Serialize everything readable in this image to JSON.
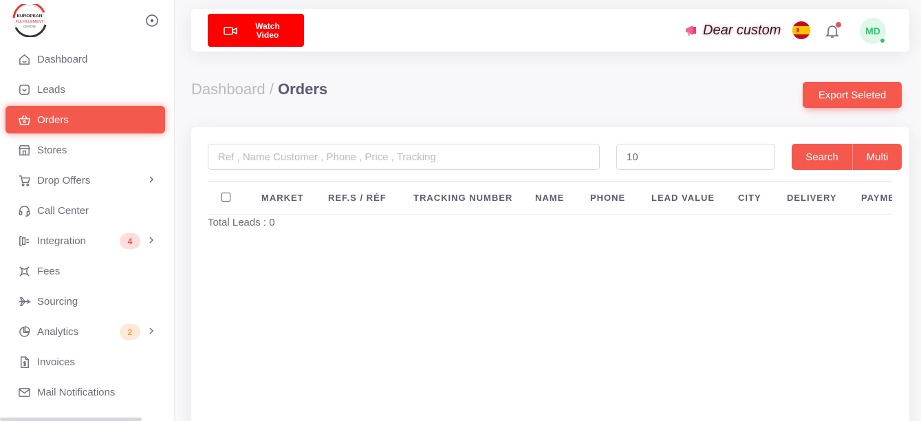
{
  "sidebar": {
    "logo_text": [
      "EUROPEAN",
      "FULFILLEMENT",
      "CENTRE"
    ],
    "items": [
      {
        "label": "Dashboard",
        "icon": "home-icon"
      },
      {
        "label": "Leads",
        "icon": "inbox-icon"
      },
      {
        "label": "Orders",
        "icon": "basket-icon",
        "active": true
      },
      {
        "label": "Stores",
        "icon": "store-icon"
      },
      {
        "label": "Drop Offers",
        "icon": "cart-icon",
        "has_children": true
      },
      {
        "label": "Call Center",
        "icon": "headset-icon"
      },
      {
        "label": "Integration",
        "icon": "integration-icon",
        "badge": "4",
        "has_children": true
      },
      {
        "label": "Fees",
        "icon": "fees-icon"
      },
      {
        "label": "Sourcing",
        "icon": "plane-icon"
      },
      {
        "label": "Analytics",
        "icon": "pie-chart-icon",
        "badge": "2",
        "has_children": true
      },
      {
        "label": "Invoices",
        "icon": "invoice-icon"
      },
      {
        "label": "Mail Notifications",
        "icon": "mail-icon"
      }
    ]
  },
  "topbar": {
    "watch_video_label": "Watch\nVideo",
    "marquee_text": "Dear custom",
    "avatar_initials": "MD"
  },
  "page": {
    "breadcrumb_parent": "Dashboard",
    "breadcrumb_sep": " / ",
    "breadcrumb_current": "Orders",
    "export_label": "Export Seleted"
  },
  "filters": {
    "search_placeholder": "Ref , Name Customer , Phone , Price , Tracking",
    "page_size": "10",
    "search_label": "Search",
    "multi_label": "Multi"
  },
  "table": {
    "columns": [
      "MARKET",
      "REF.S / RÉF",
      "TRACKING NUMBER",
      "NAME",
      "PHONE",
      "LEAD VALUE",
      "CITY",
      "DELIVERY",
      "PAYME"
    ]
  },
  "summary": {
    "total_leads": "Total Leads : 0"
  },
  "colors": {
    "accent": "#f5584d",
    "watch_button": "#ff0000"
  }
}
